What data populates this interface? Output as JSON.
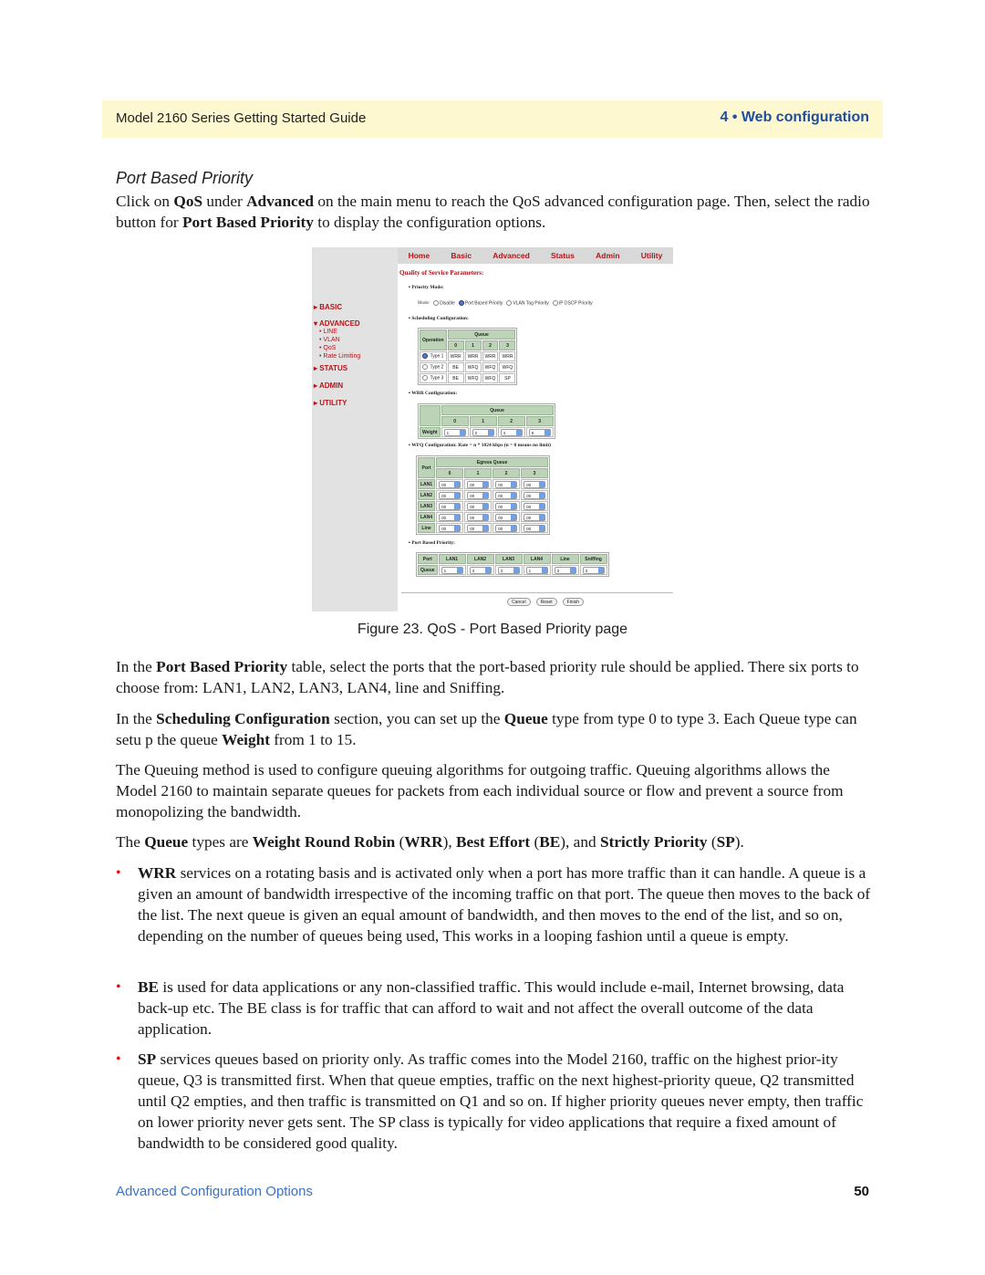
{
  "header": {
    "left": "Model 2160 Series Getting Started Guide",
    "right": "4 • Web configuration"
  },
  "section_title": "Port Based Priority",
  "intro": {
    "t1": "Click on ",
    "b1": "QoS",
    "t2": " under ",
    "b2": "Advanced",
    "t3": " on the main menu to reach the QoS advanced configuration page. Then, select the radio button for ",
    "b3": "Port Based Priority",
    "t4": " to display the configuration options."
  },
  "screenshot": {
    "nav": [
      "Home",
      "Basic",
      "Advanced",
      "Status",
      "Admin",
      "Utility"
    ],
    "sidebar": {
      "basic": "▸ BASIC",
      "advanced": "▾ ADVANCED",
      "sub": [
        "• LINE",
        "• VLAN",
        "• QoS",
        "• Rate Limiting"
      ],
      "status": "▸ STATUS",
      "admin": "▸ ADMIN",
      "utility": "▸ UTILITY"
    },
    "title": "Quality of Service Parameters:",
    "priority_mode_label": "▪ Priority Mode:",
    "mode_label": "Mode:",
    "modes": [
      "Disable",
      "Port Based Priority",
      "VLAN Tag Priority",
      "IP DSCP Priority"
    ],
    "mode_selected": "Port Based Priority",
    "scheduling_label": "▪ Scheduling Configuration:",
    "scheduling": {
      "operation_header": "Operation",
      "queue_header": "Queue",
      "queues": [
        "0",
        "1",
        "2",
        "3"
      ],
      "rows": [
        {
          "type": "Type 1",
          "selected": true,
          "values": [
            "WRR",
            "WRR",
            "WRR",
            "WRR"
          ]
        },
        {
          "type": "Type 2",
          "selected": false,
          "values": [
            "BE",
            "WFQ",
            "WFQ",
            "WFQ"
          ]
        },
        {
          "type": "Type 3",
          "selected": false,
          "values": [
            "BE",
            "WFQ",
            "WFQ",
            "SP"
          ]
        }
      ]
    },
    "wrr_label": "▪ WRR Configuration:",
    "wrr": {
      "queue_header": "Queue",
      "queues": [
        "0",
        "1",
        "2",
        "3"
      ],
      "row_label": "Weight",
      "weights": [
        "1",
        "2",
        "4",
        "8"
      ]
    },
    "wfq_label": "▪ WFQ Configuration: Rate = n * 1024 kbps (n = 0 means no limit)",
    "wfq": {
      "port_header": "Port",
      "egress_header": "Egress Queue",
      "queues": [
        "0",
        "1",
        "2",
        "3"
      ],
      "rows": [
        {
          "port": "LAN1",
          "values": [
            "00",
            "00",
            "00",
            "00"
          ]
        },
        {
          "port": "LAN2",
          "values": [
            "00",
            "00",
            "00",
            "00"
          ]
        },
        {
          "port": "LAN3",
          "values": [
            "00",
            "00",
            "00",
            "00"
          ]
        },
        {
          "port": "LAN4",
          "values": [
            "00",
            "00",
            "00",
            "00"
          ]
        },
        {
          "port": "Line",
          "values": [
            "00",
            "00",
            "00",
            "00"
          ]
        }
      ]
    },
    "pbp_label": "▪ Port Based Priority:",
    "pbp": {
      "port_header": "Port",
      "ports": [
        "LAN1",
        "LAN2",
        "LAN3",
        "LAN4",
        "Line",
        "Sniffing"
      ],
      "row_label": "Queue",
      "values": [
        "1",
        "3",
        "3",
        "1",
        "3",
        "3"
      ]
    },
    "buttons": {
      "cancel": "Cancel",
      "reset": "Reset",
      "finish": "Finish"
    }
  },
  "caption": "Figure 23. QoS - Port Based Priority page",
  "p1": {
    "t1": "In the ",
    "b1": "Port Based Priority",
    "t2": " table, select the ports that the port-based priority rule should be applied. There six ports to choose from: LAN1, LAN2, LAN3, LAN4, line and Sniffing."
  },
  "p2": {
    "t1": "In the ",
    "b1": "Scheduling Configuration",
    "t2": " section, you can set up the ",
    "b2": "Queue",
    "t3": " type from type 0 to type 3. Each Queue type can setu p the queue ",
    "b3": "Weight",
    "t4": " from 1 to 15."
  },
  "p3": "The Queuing method is used to configure queuing algorithms for outgoing traffic. Queuing algorithms allows the Model 2160 to maintain separate queues for packets from each individual source or flow and prevent a source from monopolizing the bandwidth.",
  "p4": {
    "t1": "The ",
    "b1": "Queue",
    "t2": " types are ",
    "b2": "Weight Round Robin",
    "t3": " (",
    "b3": "WRR",
    "t4": "), ",
    "b4": "Best Effort",
    "t5": " (",
    "b5": "BE",
    "t6": "), and ",
    "b6": "Strictly Priority",
    "t7": " (",
    "b7": "SP",
    "t8": ")."
  },
  "bullets": [
    {
      "term": "WRR",
      "text": " services on a rotating basis and is activated only when a port has more traffic than it can handle. A queue is a given an amount of bandwidth irrespective of the incoming traffic on that port. The queue then moves to the back of the list. The next queue is given an equal amount of bandwidth, and then moves to the end of the list, and so on, depending on the number of queues being used, This works in a looping fashion until a queue is empty."
    },
    {
      "term": "BE",
      "text": " is used for data applications or any non-classified traffic. This would include e-mail, Internet browsing, data back-up etc. The BE class is for traffic that can afford to wait and not affect the overall outcome of the data application."
    },
    {
      "term": "SP",
      "text": " services queues based on priority only. As traffic comes into the Model 2160, traffic on the highest prior-ity queue, Q3 is transmitted first. When that queue empties, traffic on the next highest-priority queue, Q2 transmitted until Q2 empties, and then traffic is transmitted on Q1 and so on. If higher priority queues never empty, then traffic on lower priority never gets sent. The SP class is typically for video applications that require a fixed amount of bandwidth to be considered good quality."
    }
  ],
  "footer": {
    "left": "Advanced Configuration Options",
    "page": "50"
  }
}
